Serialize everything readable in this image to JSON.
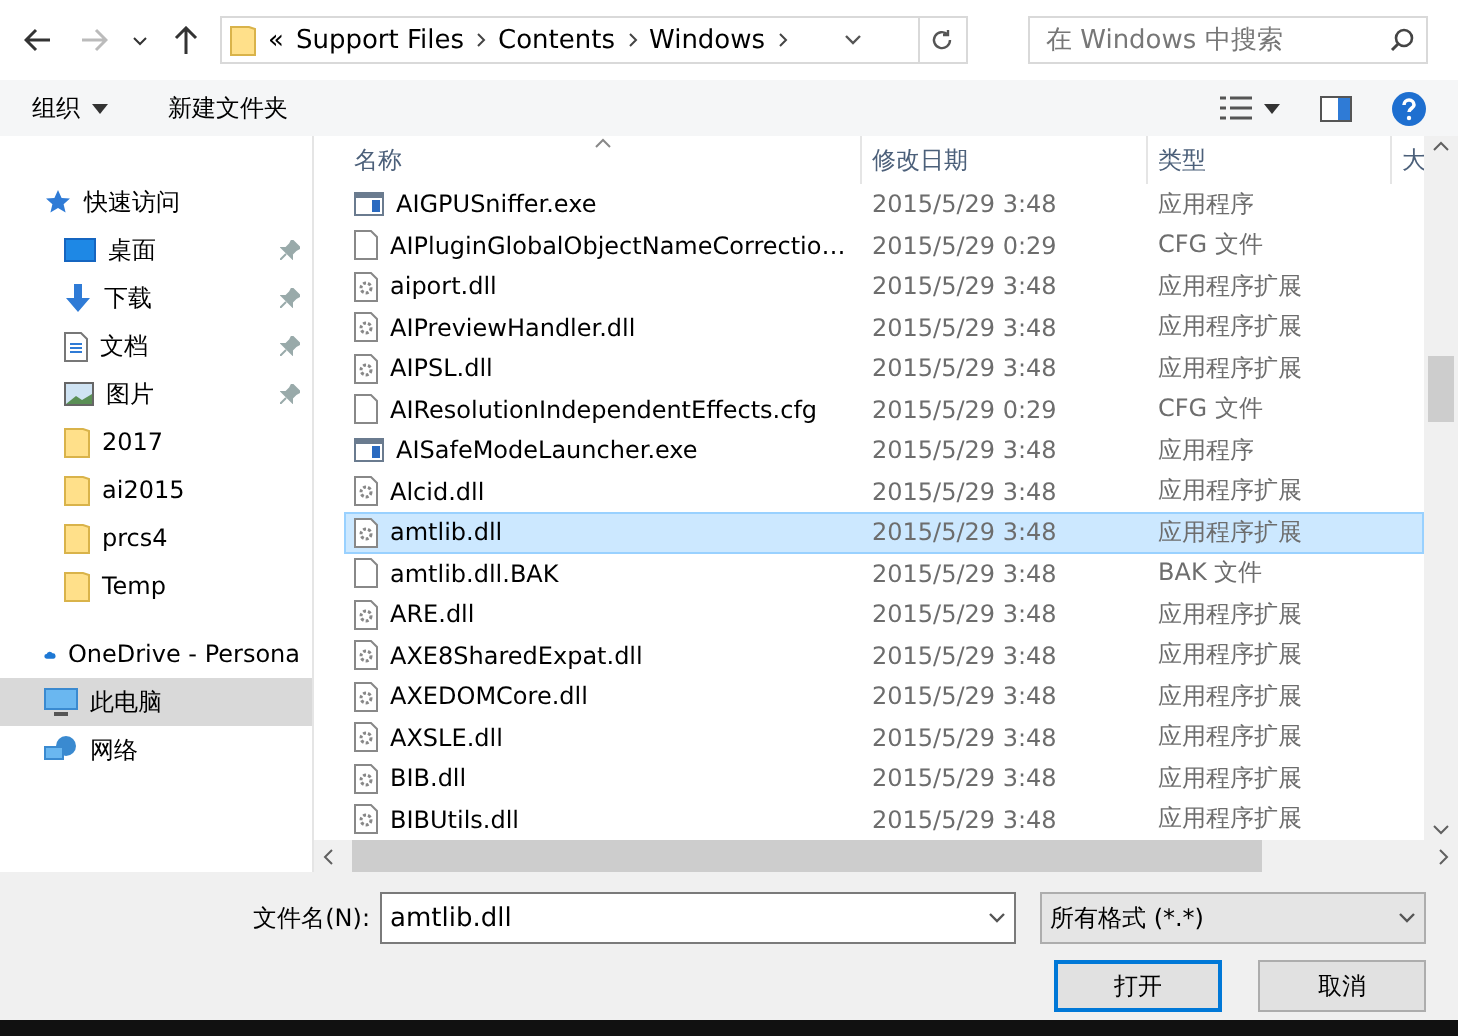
{
  "nav": {
    "forward": {
      "disabled": true
    }
  },
  "address": {
    "overflow": "«",
    "crumbs": [
      "Support Files",
      "Contents",
      "Windows"
    ]
  },
  "search": {
    "placeholder": "在 Windows 中搜索"
  },
  "toolbar": {
    "organize": "组织",
    "new_folder": "新建文件夹"
  },
  "sidebar": {
    "items": [
      {
        "label": "快速访问",
        "kind": "star",
        "pinned": false,
        "selected": false
      },
      {
        "label": "桌面",
        "kind": "desktop",
        "pinned": true,
        "selected": false
      },
      {
        "label": "下载",
        "kind": "download",
        "pinned": true,
        "selected": false
      },
      {
        "label": "文档",
        "kind": "document",
        "pinned": true,
        "selected": false
      },
      {
        "label": "图片",
        "kind": "picture",
        "pinned": true,
        "selected": false
      },
      {
        "label": "2017",
        "kind": "folder",
        "pinned": false,
        "selected": false
      },
      {
        "label": "ai2015",
        "kind": "folder",
        "pinned": false,
        "selected": false
      },
      {
        "label": "prcs4",
        "kind": "folder",
        "pinned": false,
        "selected": false
      },
      {
        "label": "Temp",
        "kind": "folder",
        "pinned": false,
        "selected": false
      },
      {
        "label": "OneDrive - Persona",
        "kind": "cloud",
        "pinned": false,
        "selected": false
      },
      {
        "label": "此电脑",
        "kind": "computer",
        "pinned": false,
        "selected": true
      },
      {
        "label": "网络",
        "kind": "network",
        "pinned": false,
        "selected": false
      }
    ]
  },
  "columns": [
    {
      "label": "名称",
      "sorted": true
    },
    {
      "label": "修改日期",
      "sorted": false
    },
    {
      "label": "类型",
      "sorted": false
    },
    {
      "label": "大",
      "sorted": false
    }
  ],
  "files": [
    {
      "name": "AIGPUSniffer.exe",
      "date": "2015/5/29 3:48",
      "type": "应用程序",
      "kind": "exe",
      "selected": false
    },
    {
      "name": "AIPluginGlobalObjectNameCorrectio…",
      "date": "2015/5/29 0:29",
      "type": "CFG 文件",
      "kind": "file",
      "selected": false
    },
    {
      "name": "aiport.dll",
      "date": "2015/5/29 3:48",
      "type": "应用程序扩展",
      "kind": "dll",
      "selected": false
    },
    {
      "name": "AIPreviewHandler.dll",
      "date": "2015/5/29 3:48",
      "type": "应用程序扩展",
      "kind": "dll",
      "selected": false
    },
    {
      "name": "AIPSL.dll",
      "date": "2015/5/29 3:48",
      "type": "应用程序扩展",
      "kind": "dll",
      "selected": false
    },
    {
      "name": "AIResolutionIndependentEffects.cfg",
      "date": "2015/5/29 0:29",
      "type": "CFG 文件",
      "kind": "file",
      "selected": false
    },
    {
      "name": "AISafeModeLauncher.exe",
      "date": "2015/5/29 3:48",
      "type": "应用程序",
      "kind": "exe",
      "selected": false
    },
    {
      "name": "Alcid.dll",
      "date": "2015/5/29 3:48",
      "type": "应用程序扩展",
      "kind": "dll",
      "selected": false
    },
    {
      "name": "amtlib.dll",
      "date": "2015/5/29 3:48",
      "type": "应用程序扩展",
      "kind": "dll",
      "selected": true
    },
    {
      "name": "amtlib.dll.BAK",
      "date": "2015/5/29 3:48",
      "type": "BAK 文件",
      "kind": "file",
      "selected": false
    },
    {
      "name": "ARE.dll",
      "date": "2015/5/29 3:48",
      "type": "应用程序扩展",
      "kind": "dll",
      "selected": false
    },
    {
      "name": "AXE8SharedExpat.dll",
      "date": "2015/5/29 3:48",
      "type": "应用程序扩展",
      "kind": "dll",
      "selected": false
    },
    {
      "name": "AXEDOMCore.dll",
      "date": "2015/5/29 3:48",
      "type": "应用程序扩展",
      "kind": "dll",
      "selected": false
    },
    {
      "name": "AXSLE.dll",
      "date": "2015/5/29 3:48",
      "type": "应用程序扩展",
      "kind": "dll",
      "selected": false
    },
    {
      "name": "BIB.dll",
      "date": "2015/5/29 3:48",
      "type": "应用程序扩展",
      "kind": "dll",
      "selected": false
    },
    {
      "name": "BIBUtils.dll",
      "date": "2015/5/29 3:48",
      "type": "应用程序扩展",
      "kind": "dll",
      "selected": false
    }
  ],
  "bottom": {
    "filename_label": "文件名(N):",
    "filename": "amtlib.dll",
    "filter": "所有格式 (*.*)",
    "buttons": [
      {
        "label": "打开",
        "primary": true
      },
      {
        "label": "取消",
        "primary": false
      }
    ]
  }
}
